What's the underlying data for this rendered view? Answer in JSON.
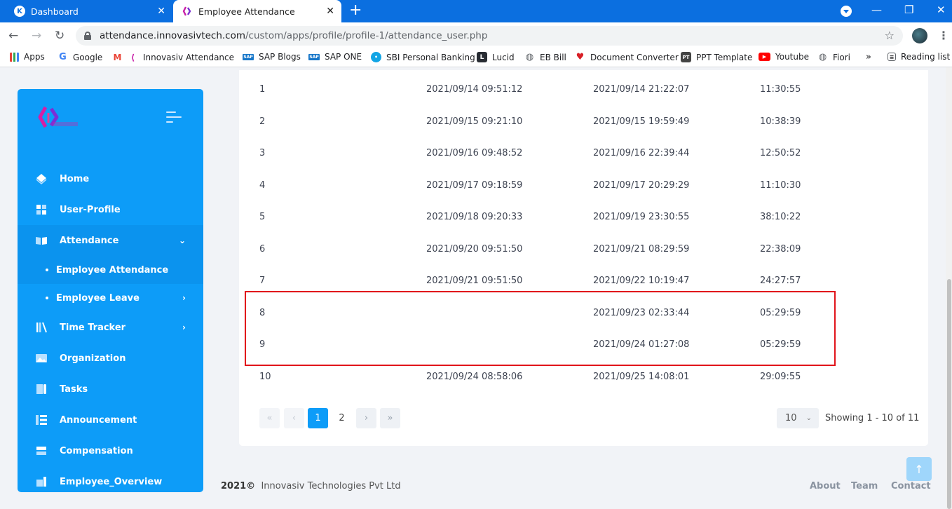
{
  "browser": {
    "tabs": [
      {
        "title": "Dashboard",
        "active": false
      },
      {
        "title": "Employee Attendance",
        "active": true
      }
    ],
    "url_domain": "attendance.innovasivtech.com",
    "url_path": "/custom/apps/profile/profile-1/attendance_user.php",
    "bookmarks": [
      "Apps",
      "Google",
      "Innovasiv Attendance",
      "SAP Blogs",
      "SAP ONE",
      "SBI Personal Banking",
      "Lucid",
      "EB Bill",
      "Document Converter",
      "PPT Template",
      "Youtube",
      "Fiori"
    ],
    "more_bookmarks": "»",
    "reading_list": "Reading list"
  },
  "sidebar": {
    "items": [
      {
        "label": "Home",
        "icon": "home-icon"
      },
      {
        "label": "User-Profile",
        "icon": "grid-icon"
      },
      {
        "label": "Attendance",
        "icon": "book-icon",
        "expanded": true
      },
      {
        "label": "Time Tracker",
        "icon": "library-icon"
      },
      {
        "label": "Organization",
        "icon": "image-icon"
      },
      {
        "label": "Tasks",
        "icon": "tasks-icon"
      },
      {
        "label": "Announcement",
        "icon": "list-icon"
      },
      {
        "label": "Compensation",
        "icon": "layers-icon"
      },
      {
        "label": "Employee_Overview",
        "icon": "chart-icon"
      }
    ],
    "sub_items": [
      {
        "label": "Employee Attendance",
        "active": true
      },
      {
        "label": "Employee Leave",
        "active": false
      }
    ]
  },
  "table": {
    "rows": [
      [
        "1",
        "2021/09/14 09:51:12",
        "2021/09/14 21:22:07",
        "11:30:55"
      ],
      [
        "2",
        "2021/09/15 09:21:10",
        "2021/09/15 19:59:49",
        "10:38:39"
      ],
      [
        "3",
        "2021/09/16 09:48:52",
        "2021/09/16 22:39:44",
        "12:50:52"
      ],
      [
        "4",
        "2021/09/17 09:18:59",
        "2021/09/17 20:29:29",
        "11:10:30"
      ],
      [
        "5",
        "2021/09/18 09:20:33",
        "2021/09/19 23:30:55",
        "38:10:22"
      ],
      [
        "6",
        "2021/09/20 09:51:50",
        "2021/09/21 08:29:59",
        "22:38:09"
      ],
      [
        "7",
        "2021/09/21 09:51:50",
        "2021/09/22 10:19:47",
        "24:27:57"
      ],
      [
        "8",
        "",
        "2021/09/23 02:33:44",
        "05:29:59"
      ],
      [
        "9",
        "",
        "2021/09/24 01:27:08",
        "05:29:59"
      ],
      [
        "10",
        "2021/09/24 08:58:06",
        "2021/09/25 14:08:01",
        "29:09:55"
      ]
    ]
  },
  "pagination": {
    "pages": [
      "1",
      "2"
    ],
    "current": "1",
    "per_page": "10",
    "showing": "Showing 1 - 10 of 11"
  },
  "footer": {
    "year": "2021©",
    "company": "Innovasiv Technologies Pvt Ltd",
    "links": [
      "About",
      "Team",
      "Contact"
    ]
  },
  "colors": {
    "sidebar": "#0d9cf8",
    "highlight": "#e1141b",
    "chrome": "#0b6fe0"
  }
}
